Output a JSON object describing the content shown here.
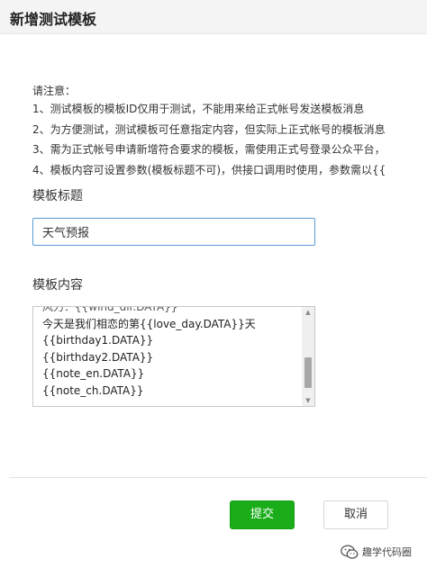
{
  "dialog": {
    "title": "新增测试模板"
  },
  "notice": {
    "heading": "请注意：",
    "lines": [
      "1、测试模板的模板ID仅用于测试，不能用来给正式帐号发送模板消息",
      "2、为方便测试，测试模板可任意指定内容，但实际上正式帐号的模板消息",
      "3、需为正式帐号申请新增符合要求的模板，需使用正式号登录公众平台，",
      "4、模板内容可设置参数(模板标题不可)，供接口调用时使用，参数需以{{"
    ]
  },
  "form": {
    "title_label": "模板标题",
    "title_value": "天气预报",
    "content_label": "模板内容",
    "content_lines": [
      "风力：{{wind_dir.DATA}}",
      "今天是我们相恋的第{{love_day.DATA}}天",
      "{{birthday1.DATA}}",
      "{{birthday2.DATA}}",
      "{{note_en.DATA}}",
      "{{note_ch.DATA}}"
    ]
  },
  "buttons": {
    "submit_label": "提交",
    "cancel_label": "取消"
  },
  "watermark": {
    "text": "趣学代码圈"
  },
  "colors": {
    "primary": "#1aad19",
    "input_focus": "#5b9bd5",
    "header_bg": "#f4f4f4"
  }
}
